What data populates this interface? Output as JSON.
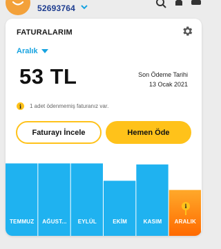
{
  "account": {
    "number": "52693764"
  },
  "card": {
    "title": "FATURALARIM",
    "month_select": "Aralık",
    "amount": "53 TL",
    "due_label": "Son Ödeme Tarihi",
    "due_date": "13 Ocak 2021",
    "notice_badge": "i",
    "notice": "1 adet ödenmemiş faturanız var.",
    "btn_review": "Faturayı İncele",
    "btn_pay": "Hemen Öde"
  },
  "chart_data": {
    "type": "bar",
    "categories": [
      "TEMMUZ",
      "AĞUST...",
      "EYLÜL",
      "EKİM",
      "KASIM",
      "ARALIK"
    ],
    "values": [
      71,
      71,
      71,
      54,
      70,
      45
    ],
    "selected_index": 5,
    "selected_marker": "i",
    "colors": {
      "bar": "#1fb2f0",
      "bar_dark": "#0a9ee0",
      "selected_top": "#ffa92a",
      "selected_bottom": "#ff6a00"
    }
  }
}
